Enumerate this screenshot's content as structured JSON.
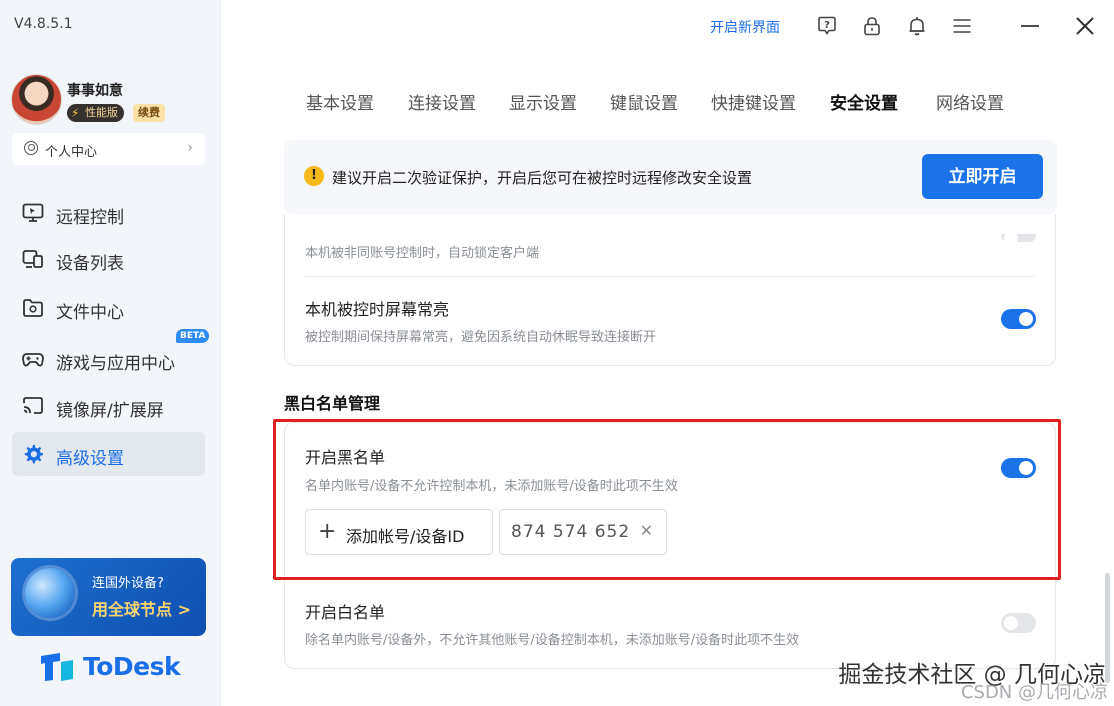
{
  "app": {
    "version": "V4.8.5.1",
    "brand": "ToDesk"
  },
  "user": {
    "name": "事事如意",
    "badge_perf": "性能版",
    "badge_renew": "续费",
    "personal_center": "个人中心"
  },
  "sidebar": {
    "items": [
      {
        "label": "远程控制",
        "icon": "monitor-icon"
      },
      {
        "label": "设备列表",
        "icon": "devices-icon"
      },
      {
        "label": "文件中心",
        "icon": "folder-icon"
      },
      {
        "label": "游戏与应用中心",
        "icon": "gamepad-icon",
        "badge": "BETA"
      },
      {
        "label": "镜像屏/扩展屏",
        "icon": "cast-icon"
      },
      {
        "label": "高级设置",
        "icon": "gear-icon",
        "active": true
      }
    ]
  },
  "promo": {
    "line1": "连国外设备?",
    "line2": "用全球节点 >"
  },
  "topbar": {
    "new_ui": "开启新界面",
    "icons": [
      "help-icon",
      "lock-icon",
      "bell-icon",
      "menu-icon",
      "minimize-icon",
      "close-icon"
    ]
  },
  "tabs": [
    {
      "label": "基本设置"
    },
    {
      "label": "连接设置"
    },
    {
      "label": "显示设置"
    },
    {
      "label": "键鼠设置"
    },
    {
      "label": "快捷键设置"
    },
    {
      "label": "安全设置",
      "active": true
    },
    {
      "label": "网络设置"
    }
  ],
  "notice": {
    "text": "建议开启二次验证保护，开启后您可在被控时远程修改安全设置",
    "button": "立即开启"
  },
  "security_card": {
    "row1_desc": "本机被非同账号控制时，自动锁定客户端",
    "row2_title": "本机被控时屏幕常亮",
    "row2_desc": "被控制期间保持屏幕常亮，避免因系统自动休眠导致连接断开",
    "row2_enabled": true
  },
  "list_section": {
    "title": "黑白名单管理",
    "blacklist": {
      "title": "开启黑名单",
      "desc": "名单内账号/设备不允许控制本机，未添加账号/设备时此项不生效",
      "enabled": true,
      "add_button": "添加帐号/设备ID",
      "entries": [
        "874 574 652"
      ]
    },
    "whitelist": {
      "title": "开启白名单",
      "desc": "除名单内账号/设备外，不允许其他账号/设备控制本机，未添加账号/设备时此项不生效",
      "enabled": false
    }
  },
  "watermark": {
    "main": "掘金技术社区 @ 几何心凉",
    "sub": "CSDN @几何心凉"
  },
  "colors": {
    "accent": "#1a73e8",
    "highlight": "#e02020",
    "promo_bg": "#1f6fd0",
    "warning": "#f5b91c"
  }
}
